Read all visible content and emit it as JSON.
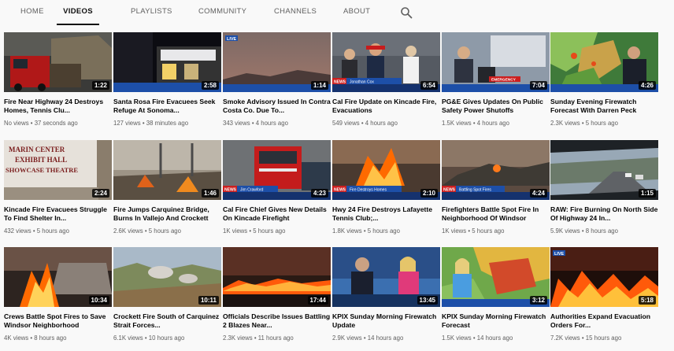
{
  "tabs": [
    {
      "label": "HOME",
      "active": false
    },
    {
      "label": "VIDEOS",
      "active": true
    },
    {
      "label": "PLAYLISTS",
      "active": false
    },
    {
      "label": "COMMUNITY",
      "active": false
    },
    {
      "label": "CHANNELS",
      "active": false
    },
    {
      "label": "ABOUT",
      "active": false
    }
  ],
  "search_icon": "search-icon",
  "videos": [
    {
      "title": "Fire Near Highway 24 Destroys Homes, Tennis Clu...",
      "views": "No views",
      "age": "37 seconds ago",
      "duration": "1:22"
    },
    {
      "title": "Santa Rosa Fire Evacuees Seek Refuge At Sonoma...",
      "views": "127 views",
      "age": "38 minutes ago",
      "duration": "2:58"
    },
    {
      "title": "Smoke Advisory Issued In Contra Costa Co. Due To...",
      "views": "343 views",
      "age": "4 hours ago",
      "duration": "1:14"
    },
    {
      "title": "Cal Fire Update on Kincade Fire, Evacuations",
      "views": "549 views",
      "age": "4 hours ago",
      "duration": "6:54"
    },
    {
      "title": "PG&E Gives Updates On Public Safety Power Shutoffs",
      "views": "1.5K views",
      "age": "4 hours ago",
      "duration": "7:04"
    },
    {
      "title": "Sunday Evening Firewatch Forecast With Darren Peck",
      "views": "2.3K views",
      "age": "5 hours ago",
      "duration": "4:26"
    },
    {
      "title": "Kincade Fire Evacuees Struggle To Find Shelter In...",
      "views": "432 views",
      "age": "5 hours ago",
      "duration": "2:24"
    },
    {
      "title": "Fire Jumps Carquinez Bridge, Burns In Vallejo And Crockett",
      "views": "2.6K views",
      "age": "5 hours ago",
      "duration": "1:46"
    },
    {
      "title": "Cal Fire Chief Gives New Details On Kincade Firefight",
      "views": "1K views",
      "age": "5 hours ago",
      "duration": "4:23"
    },
    {
      "title": "Hwy 24 Fire Destroys Lafayette Tennis Club;...",
      "views": "1.8K views",
      "age": "5 hours ago",
      "duration": "2:10"
    },
    {
      "title": "Firefighters Battle Spot Fire In Neighborhood Of Windsor",
      "views": "1K views",
      "age": "5 hours ago",
      "duration": "4:24"
    },
    {
      "title": "RAW: Fire Burning On North Side Of Highway 24 In...",
      "views": "5.9K views",
      "age": "8 hours ago",
      "duration": "1:15"
    },
    {
      "title": "Crews Battle Spot Fires to Save Windsor Neighborhood",
      "views": "4K views",
      "age": "8 hours ago",
      "duration": "10:34"
    },
    {
      "title": "Crockett Fire South of Carquinez Strait Forces...",
      "views": "6.1K views",
      "age": "10 hours ago",
      "duration": "10:11"
    },
    {
      "title": "Officials Describe Issues Battling 2 Blazes Near...",
      "views": "2.3K views",
      "age": "11 hours ago",
      "duration": "17:44"
    },
    {
      "title": "KPIX Sunday Morning Firewatch Update",
      "views": "2.9K views",
      "age": "14 hours ago",
      "duration": "13:45"
    },
    {
      "title": "KPIX Sunday Morning Firewatch Forecast",
      "views": "1.5K views",
      "age": "14 hours ago",
      "duration": "3:12"
    },
    {
      "title": "Authorities Expand Evacuation Orders For...",
      "views": "7.2K views",
      "age": "15 hours ago",
      "duration": "5:18"
    }
  ],
  "thumb_text": {
    "live": "LIVE",
    "news": "NEWS",
    "lower_third_4": "Jonathan Cox",
    "lower_third_5": "EMERGENCY",
    "lower_third_9": "Jim Crawford",
    "lower_third_10": "Fire Destroys Homes",
    "lower_third_11": "Battling Spot Fires",
    "sign_line1": "MARIN CENTER",
    "sign_line2": "EXHIBIT HALL",
    "sign_line3": "SHOWCASE THEATRE"
  },
  "colors": {
    "active_tab": "#0f0f0f",
    "tab_text": "#606060",
    "news_red": "#cc1f1f",
    "news_blue": "#1d4fa8",
    "fire_orange": "#ff6a00"
  }
}
